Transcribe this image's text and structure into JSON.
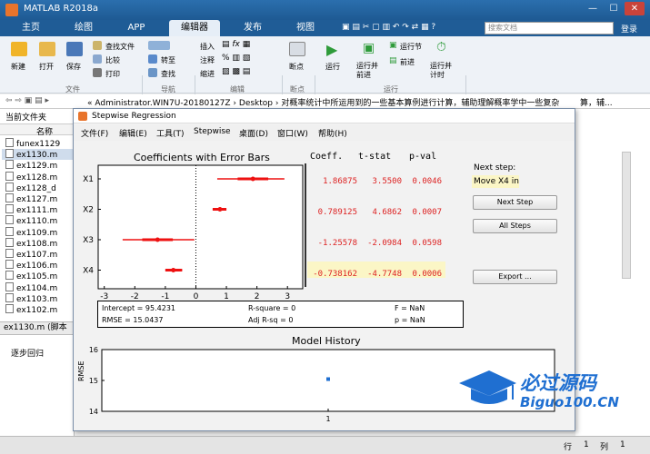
{
  "app": {
    "title": "MATLAB R2018a"
  },
  "ribbon": {
    "tabs": [
      "主页",
      "绘图",
      "APP",
      "编辑器",
      "发布",
      "视图"
    ],
    "search_placeholder": "搜索文档",
    "login": "登录",
    "tools": {
      "new": "新建",
      "open": "打开",
      "save": "保存",
      "find_files": "查找文件",
      "compare": "比较",
      "print": "打印",
      "goto": "转至",
      "find": "查找",
      "insert": "插入",
      "comment": "注释",
      "indent": "缩进",
      "breakpoints": "断点",
      "run": "运行",
      "run_advance": "运行并前进",
      "run_section": "运行节",
      "advance": "前进",
      "run_time": "运行并计时"
    },
    "groups": {
      "file": "文件",
      "nav": "导航",
      "edit": "编辑",
      "bp": "断点",
      "run": "运行"
    }
  },
  "address": {
    "path": "« Administrator.WIN7U-20180127Z › Desktop › 对概率统计中所运用到的一些基本算例进行计算，辅助理解概率学中一些复杂的知识点",
    "tail": "算，辅..."
  },
  "left": {
    "header": "当前文件夹",
    "col": "名称",
    "files": [
      "funex1129",
      "ex1130.m",
      "ex1129.m",
      "ex1128.m",
      "ex1128_d",
      "ex1127.m",
      "ex1111.m",
      "ex1110.m",
      "ex1109.m",
      "ex1108.m",
      "ex1107.m",
      "ex1106.m",
      "ex1105.m",
      "ex1104.m",
      "ex1103.m",
      "ex1102.m"
    ],
    "details": "ex1130.m (脚本",
    "workspace": "逐步回归"
  },
  "status": {
    "row_label": "行",
    "row": "1",
    "col_label": "列",
    "col": "1"
  },
  "dialog": {
    "title": "Stepwise Regression",
    "menu": [
      "文件(F)",
      "编辑(E)",
      "工具(T)",
      "Stepwise",
      "桌面(D)",
      "窗口(W)",
      "帮助(H)"
    ],
    "coef_title": "Coefficients with Error Bars",
    "col_headers": [
      "Coeff.",
      "t-stat",
      "p-val"
    ],
    "rows": [
      {
        "label": "X1",
        "coeff": "1.86875",
        "tstat": "3.5500",
        "pval": "0.0046"
      },
      {
        "label": "X2",
        "coeff": "0.789125",
        "tstat": "4.6862",
        "pval": "0.0007"
      },
      {
        "label": "X3",
        "coeff": "-1.25578",
        "tstat": "-2.0984",
        "pval": "0.0598"
      },
      {
        "label": "X4",
        "coeff": "-0.738162",
        "tstat": "-4.7748",
        "pval": "0.0006"
      }
    ],
    "next_step_label": "Next step:",
    "next_step_value": "Move X4 in",
    "buttons": {
      "next": "Next Step",
      "all": "All Steps",
      "export": "Export ..."
    },
    "stats": {
      "intercept": "Intercept = 95.4231",
      "rmse": "RMSE = 15.0437",
      "rsq": "R-square = 0",
      "adjrsq": "Adj R-sq = 0",
      "f": "F = NaN",
      "p": "p = NaN"
    },
    "history_title": "Model History",
    "history_ylabel": "RMSE"
  },
  "chart_data": [
    {
      "type": "scatter",
      "title": "Coefficients with Error Bars",
      "categories": [
        "X1",
        "X2",
        "X3",
        "X4"
      ],
      "x_ticks": [
        -3,
        -2,
        -1,
        0,
        1,
        2,
        3
      ],
      "xlim": [
        -3.2,
        3.5
      ],
      "series": [
        {
          "values": [
            1.86875,
            0.789125,
            -1.25578,
            -0.738162
          ],
          "ci_low": [
            0.7,
            0.55,
            -2.4,
            -1.0
          ],
          "ci_high": [
            2.9,
            1.0,
            -0.05,
            -0.45
          ]
        }
      ]
    },
    {
      "type": "scatter",
      "title": "Model History",
      "ylabel": "RMSE",
      "x_ticks": [
        1
      ],
      "y_ticks": [
        14,
        15,
        16
      ],
      "ylim": [
        14,
        16
      ],
      "x": [
        1
      ],
      "values": [
        15.0437
      ]
    }
  ],
  "watermark": {
    "cn": "必过源码",
    "en": "Biguo100.CN"
  }
}
